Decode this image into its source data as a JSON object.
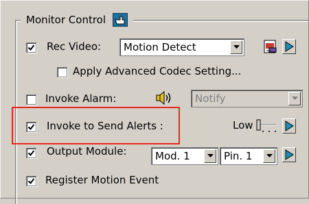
{
  "group": {
    "title": "Monitor Control"
  },
  "rows": {
    "rec_video": {
      "label": "Rec Video:",
      "checked": true,
      "select_value": "Motion Detect"
    },
    "codec": {
      "label": "Apply Advanced Codec Setting...",
      "checked": false
    },
    "alarm": {
      "label": "Invoke Alarm:",
      "checked": false,
      "select_value": "Notify"
    },
    "alerts": {
      "label": "Invoke to Send Alerts :",
      "checked": true,
      "level": "Low"
    },
    "output": {
      "label": "Output Module:",
      "checked": true,
      "module_value": "Mod. 1",
      "pin_value": "Pin. 1"
    },
    "register": {
      "label": "Register Motion Event",
      "checked": true
    }
  },
  "colors": {
    "highlight": "#e8271f",
    "play": "#1a8fb5",
    "face": "#d4d0c8"
  },
  "icons": [
    "hand-pointer-icon",
    "settings-doc-icon",
    "play-icon",
    "speaker-icon",
    "slider-icon",
    "chevron-down-icon",
    "checkmark-icon"
  ]
}
